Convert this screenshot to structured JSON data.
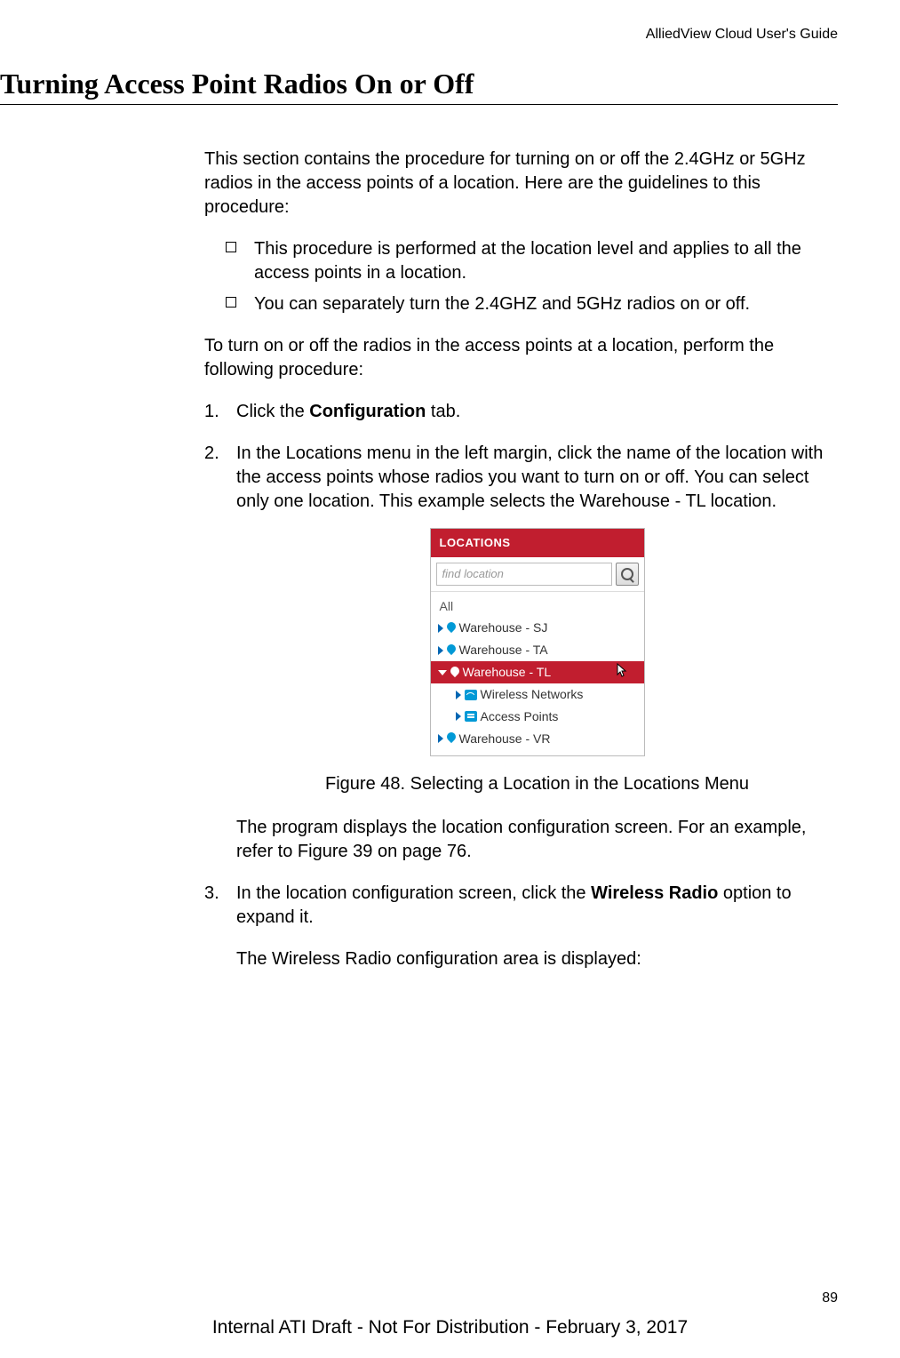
{
  "header": {
    "doc_title": "AlliedView Cloud User's Guide"
  },
  "section": {
    "title": "Turning Access Point Radios On or Off"
  },
  "intro": "This section contains the procedure for turning on or off the 2.4GHz or 5GHz radios in the access points of a location. Here are the guidelines to this procedure:",
  "bullets": [
    "This procedure is performed at the location level and applies to all the access points in a location.",
    "You can separately turn the 2.4GHZ and 5GHz radios on or off."
  ],
  "lead": "To turn on or off the radios in the access points at a location, perform the following procedure:",
  "steps": {
    "s1": {
      "num": "1.",
      "pre": "Click the ",
      "bold": "Configuration",
      "post": " tab."
    },
    "s2": {
      "num": "2.",
      "text": "In the Locations menu in the left margin, click the name of the location with the access points whose radios you want to turn on or off. You can select only one location. This example selects the Warehouse - TL location."
    },
    "s3": {
      "num": "3.",
      "pre": "In the location configuration screen, click the ",
      "bold": "Wireless Radio",
      "post": " option to expand it."
    }
  },
  "figure": {
    "panel_title": "LOCATIONS",
    "search_placeholder": "find location",
    "all": "All",
    "items": {
      "sj": "Warehouse - SJ",
      "ta": "Warehouse - TA",
      "tl": "Warehouse - TL",
      "wn": "Wireless Networks",
      "ap": "Access Points",
      "vr": "Warehouse - VR"
    },
    "caption": "Figure 48. Selecting a Location in the Locations Menu"
  },
  "after_fig": "The program displays the location configuration screen. For an example, refer to Figure 39 on page 76.",
  "after_s3": "The Wireless Radio configuration area is displayed:",
  "page_number": "89",
  "footer": "Internal ATI Draft - Not For Distribution - February 3, 2017"
}
